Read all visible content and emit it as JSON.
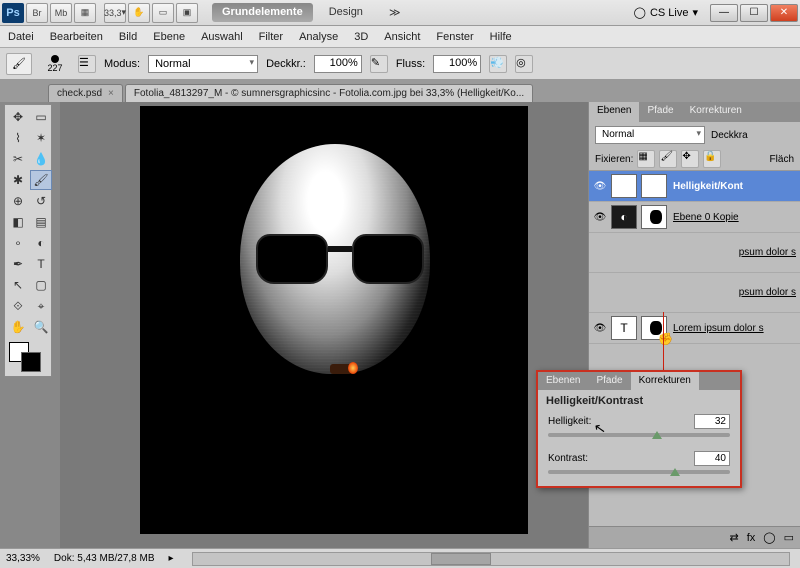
{
  "titlebar": {
    "zoom_display": "33,3",
    "mode_active": "Grundelemente",
    "mode_second": "Design",
    "cslive": "CS Live"
  },
  "menubar": [
    "Datei",
    "Bearbeiten",
    "Bild",
    "Ebene",
    "Auswahl",
    "Filter",
    "Analyse",
    "3D",
    "Ansicht",
    "Fenster",
    "Hilfe"
  ],
  "optbar": {
    "brush_size": "227",
    "modus_label": "Modus:",
    "modus_value": "Normal",
    "deckkr_label": "Deckkr.:",
    "deckkr_value": "100%",
    "fluss_label": "Fluss:",
    "fluss_value": "100%"
  },
  "tabs": [
    {
      "label": "check.psd"
    },
    {
      "label": "Fotolia_4813297_M - © sumnersgraphicsinc - Fotolia.com.jpg bei 33,3% (Helligkeit/Ko..."
    }
  ],
  "panels": {
    "tab1": "Ebenen",
    "tab2": "Pfade",
    "tab3": "Korrekturen",
    "blend_mode": "Normal",
    "deckkr_label": "Deckkra",
    "fixieren_label": "Fixieren:",
    "flach_label": "Fläch",
    "layers": [
      {
        "name": "Helligkeit/Kont"
      },
      {
        "name": "Ebene 0 Kopie"
      },
      {
        "name": "psum dolor s"
      },
      {
        "name": "psum dolor s"
      },
      {
        "name": "Lorem ipsum dolor s"
      }
    ]
  },
  "adjustment": {
    "tab1": "Ebenen",
    "tab2": "Pfade",
    "tab3": "Korrekturen",
    "title": "Helligkeit/Kontrast",
    "helligkeit_label": "Helligkeit:",
    "helligkeit_value": "32",
    "kontrast_label": "Kontrast:",
    "kontrast_value": "40"
  },
  "statusbar": {
    "zoom": "33,33%",
    "dok": "Dok: 5,43 MB/27,8 MB"
  }
}
